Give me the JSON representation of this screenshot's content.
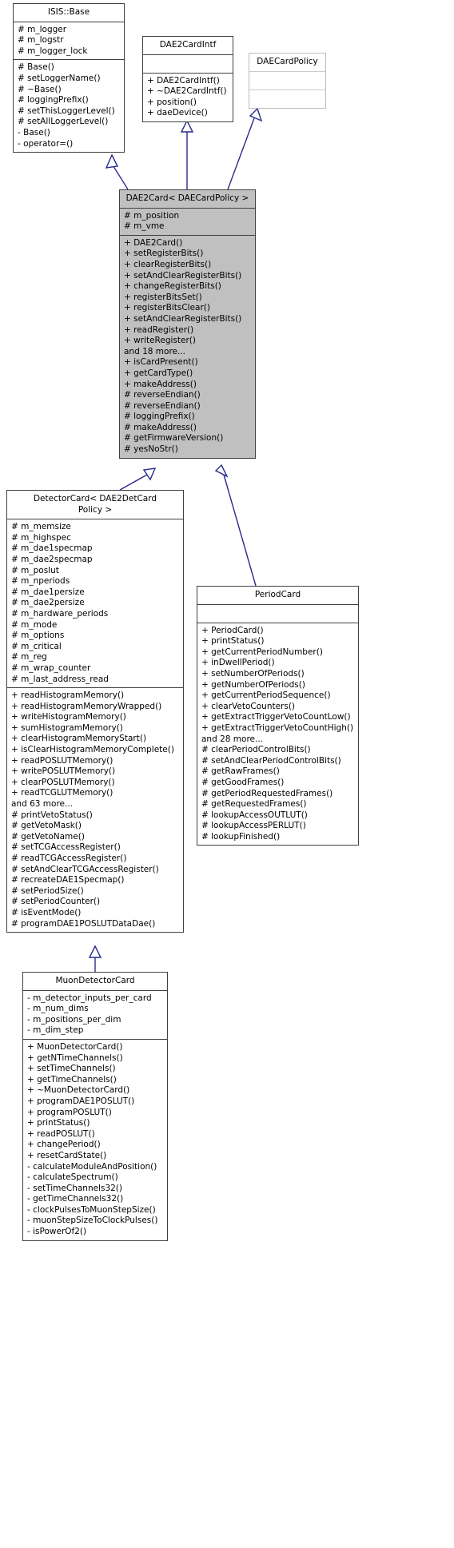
{
  "diagram": {
    "type": "uml-class-inheritance",
    "title_text": "",
    "colors": {
      "edge": "#2a2a8c",
      "node_border": "#404040",
      "node_fill_plain": "#ffffff",
      "node_fill_highlight": "#c0c0c0",
      "faint_border": "#bbbbbb",
      "text": "#000000"
    }
  },
  "nodes": {
    "isis_base": {
      "name": "ISIS::Base",
      "attributes": [
        "# m_logger",
        "# m_logstr",
        "# m_logger_lock"
      ],
      "operations": [
        "# Base()",
        "# setLoggerName()",
        "# ~Base()",
        "# loggingPrefix()",
        "# setThisLoggerLevel()",
        "# setAllLoggerLevel()",
        "- Base()",
        "- operator=()"
      ]
    },
    "dae2cardintf": {
      "name": "DAE2CardIntf",
      "attributes": [],
      "operations": [
        "+ DAE2CardIntf()",
        "+ ~DAE2CardIntf()",
        "+ position()",
        "+ daeDevice()"
      ]
    },
    "daecardpolicy": {
      "name": "DAECardPolicy",
      "attributes": [],
      "operations": []
    },
    "dae2card": {
      "name": "DAE2Card< DAECardPolicy >",
      "attributes": [
        "# m_position",
        "# m_vme"
      ],
      "operations": [
        "+ DAE2Card()",
        "+ setRegisterBits()",
        "+ clearRegisterBits()",
        "+ setAndClearRegisterBits()",
        "+ changeRegisterBits()",
        "+ registerBitsSet()",
        "+ registerBitsClear()",
        "+ setAndClearRegisterBits()",
        "+ readRegister()",
        "+ writeRegister()",
        "and 18 more...",
        "+ isCardPresent()",
        "+ getCardType()",
        "+ makeAddress()",
        "# reverseEndian()",
        "# reverseEndian()",
        "# loggingPrefix()",
        "# makeAddress()",
        "# getFirmwareVersion()",
        "# yesNoStr()"
      ]
    },
    "detectorcard": {
      "name": "DetectorCard< DAE2DetCard\nPolicy >",
      "attributes": [
        "# m_memsize",
        "# m_highspec",
        "# m_dae1specmap",
        "# m_dae2specmap",
        "# m_poslut",
        "# m_nperiods",
        "# m_dae1persize",
        "# m_dae2persize",
        "# m_hardware_periods",
        "# m_mode",
        "# m_options",
        "# m_critical",
        "# m_reg",
        "# m_wrap_counter",
        "# m_last_address_read"
      ],
      "operations": [
        "+ readHistogramMemory()",
        "+ readHistogramMemoryWrapped()",
        "+ writeHistogramMemory()",
        "+ sumHistogramMemory()",
        "+ clearHistogramMemoryStart()",
        "+ isClearHistogramMemoryComplete()",
        "+ readPOSLUTMemory()",
        "+ writePOSLUTMemory()",
        "+ clearPOSLUTMemory()",
        "+ readTCGLUTMemory()",
        "and 63 more...",
        "# printVetoStatus()",
        "# getVetoMask()",
        "# getVetoName()",
        "# setTCGAccessRegister()",
        "# readTCGAccessRegister()",
        "# setAndClearTCGAccessRegister()",
        "# recreateDAE1Specmap()",
        "# setPeriodSize()",
        "# setPeriodCounter()",
        "# isEventMode()",
        "# programDAE1POSLUTDataDae()"
      ]
    },
    "periodcard": {
      "name": "PeriodCard",
      "attributes": [],
      "operations": [
        "+ PeriodCard()",
        "+ printStatus()",
        "+ getCurrentPeriodNumber()",
        "+ inDwellPeriod()",
        "+ setNumberOfPeriods()",
        "+ getNumberOfPeriods()",
        "+ getCurrentPeriodSequence()",
        "+ clearVetoCounters()",
        "+ getExtractTriggerVetoCountLow()",
        "+ getExtractTriggerVetoCountHigh()",
        "and 28 more...",
        "# clearPeriodControlBits()",
        "# setAndClearPeriodControlBits()",
        "# getRawFrames()",
        "# getGoodFrames()",
        "# getPeriodRequestedFrames()",
        "# getRequestedFrames()",
        "# lookupAccessOUTLUT()",
        "# lookupAccessPERLUT()",
        "# lookupFinished()"
      ]
    },
    "muondetectorcard": {
      "name": "MuonDetectorCard",
      "attributes": [
        "- m_detector_inputs_per_card",
        "- m_num_dims",
        "- m_positions_per_dim",
        "- m_dim_step"
      ],
      "operations": [
        "+ MuonDetectorCard()",
        "+ getNTimeChannels()",
        "+ setTimeChannels()",
        "+ getTimeChannels()",
        "+ ~MuonDetectorCard()",
        "+ programDAE1POSLUT()",
        "+ programPOSLUT()",
        "+ printStatus()",
        "+ readPOSLUT()",
        "+ changePeriod()",
        "+ resetCardState()",
        "- calculateModuleAndPosition()",
        "- calculateSpectrum()",
        "- setTimeChannels32()",
        "- getTimeChannels32()",
        "- clockPulsesToMuonStepSize()",
        "- muonStepSizeToClockPulses()",
        "- isPowerOf2()"
      ]
    }
  },
  "edges": [
    {
      "from": "dae2card",
      "to": "isis_base",
      "kind": "generalization"
    },
    {
      "from": "dae2card",
      "to": "dae2cardintf",
      "kind": "generalization"
    },
    {
      "from": "dae2card",
      "to": "daecardpolicy",
      "kind": "generalization"
    },
    {
      "from": "detectorcard",
      "to": "dae2card",
      "kind": "generalization"
    },
    {
      "from": "periodcard",
      "to": "dae2card",
      "kind": "generalization"
    },
    {
      "from": "muondetectorcard",
      "to": "detectorcard",
      "kind": "generalization"
    }
  ]
}
